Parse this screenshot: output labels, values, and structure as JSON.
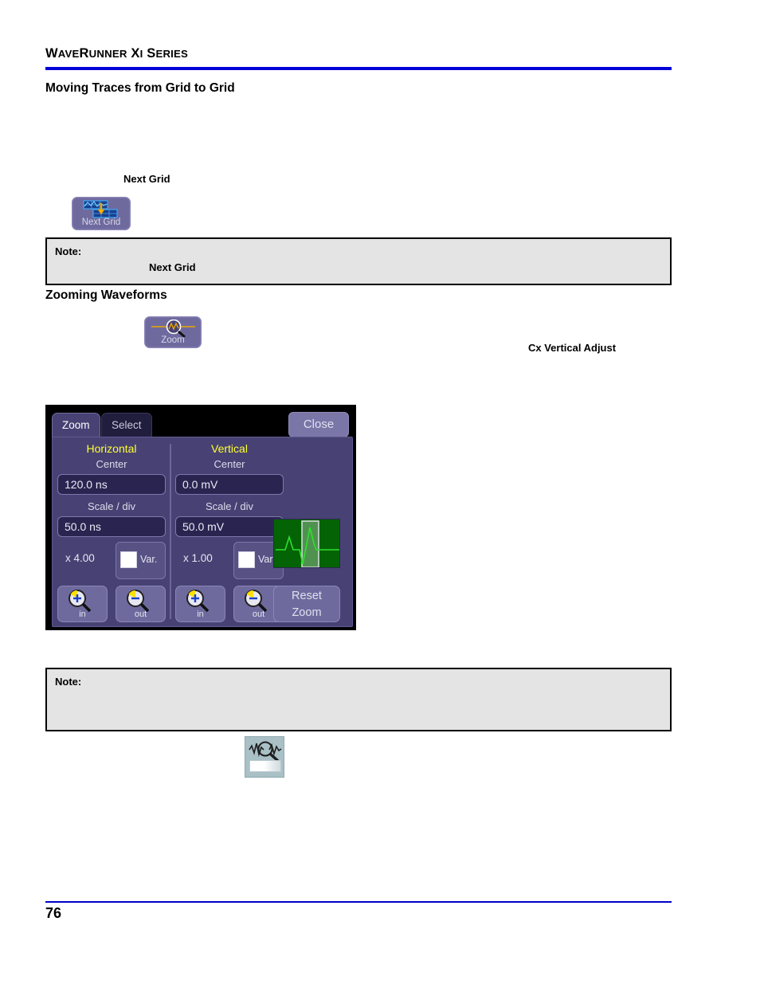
{
  "document": {
    "header_title": "WAVERUNNER XI SERIES",
    "header_parts": {
      "w": "W",
      "ave": "AVE",
      "r": "R",
      "unner": "UNNER",
      "x": "X",
      "i": "I",
      "s": "S",
      "eries": "ERIES"
    },
    "page_number": "76"
  },
  "sections": {
    "moving_traces_heading": "Moving Traces from Grid to Grid",
    "zooming_heading": "Zooming Waveforms",
    "next_grid_caption": "Next Grid",
    "cx_vertical_adjust": "Cx Vertical Adjust"
  },
  "notes": [
    {
      "label": "Note:",
      "body": "Next Grid"
    },
    {
      "label": "Note:",
      "body": ""
    }
  ],
  "buttons": {
    "next_grid": {
      "label": "Next Grid",
      "icon": "next-grid-icon"
    },
    "zoom": {
      "label": "Zoom",
      "icon": "zoom-magnifier-icon"
    },
    "toolbar_zoom": {
      "icon": "zoom-tool-icon"
    }
  },
  "zoom_dialog": {
    "tabs": [
      {
        "id": "zoom",
        "label": "Zoom",
        "active": true
      },
      {
        "id": "select",
        "label": "Select",
        "active": false
      }
    ],
    "close_label": "Close",
    "reset_label_line1": "Reset",
    "reset_label_line2": "Zoom",
    "columns": [
      {
        "title": "Horizontal",
        "center_label": "Center",
        "center_value": "120.0 ns",
        "scale_label": "Scale / div",
        "scale_value": "50.0 ns",
        "multiplier": "x 4.00",
        "var_label": "Var.",
        "var_checked": false,
        "zoom_in_label": "in",
        "zoom_out_label": "out"
      },
      {
        "title": "Vertical",
        "center_label": "Center",
        "center_value": "0.0 mV",
        "scale_label": "Scale / div",
        "scale_value": "50.0 mV",
        "multiplier": "x 1.00",
        "var_label": "Var.",
        "var_checked": false,
        "zoom_in_label": "in",
        "zoom_out_label": "out"
      }
    ],
    "preview": {
      "name": "waveform-preview",
      "trace_color": "#2ee02e",
      "background": "#046304"
    }
  },
  "colors": {
    "rule_blue": "#0000d8",
    "panel_purple": "#474273",
    "button_purple": "#6f6a9e",
    "field_navy": "#2a2550",
    "title_yellow": "#ffff33",
    "note_gray": "#e4e4e4"
  }
}
